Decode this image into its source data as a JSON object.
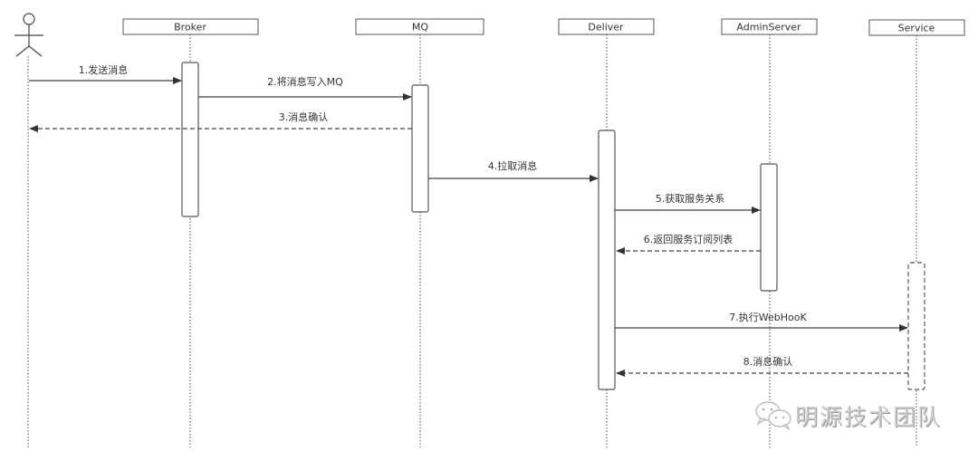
{
  "actor": {
    "name": "",
    "icon": "stick-figure-actor-icon"
  },
  "participants": [
    {
      "id": "broker",
      "label": "Broker"
    },
    {
      "id": "mq",
      "label": "MQ"
    },
    {
      "id": "deliver",
      "label": "Deliver"
    },
    {
      "id": "adminserver",
      "label": "AdminServer"
    },
    {
      "id": "service",
      "label": "Service"
    }
  ],
  "messages": [
    {
      "label": "1.发送消息",
      "from": "actor",
      "to": "broker",
      "style": "solid"
    },
    {
      "label": "2.将消息写入MQ",
      "from": "broker",
      "to": "mq",
      "style": "solid"
    },
    {
      "label": "3.消息确认",
      "from": "mq",
      "to": "actor",
      "style": "dashed"
    },
    {
      "label": "4.拉取消息",
      "from": "mq",
      "to": "deliver",
      "style": "solid"
    },
    {
      "label": "5.获取服务关系",
      "from": "deliver",
      "to": "adminserver",
      "style": "solid"
    },
    {
      "label": "6.返回服务订阅列表",
      "from": "adminserver",
      "to": "deliver",
      "style": "dashed"
    },
    {
      "label": "7.执行WebHooK",
      "from": "deliver",
      "to": "service",
      "style": "solid"
    },
    {
      "label": "8.消息确认",
      "from": "service",
      "to": "deliver",
      "style": "dashed"
    }
  ],
  "watermark": {
    "text": "明源技术团队",
    "icon": "wechat-icon"
  },
  "colors": {
    "line": "#555555",
    "text": "#333333",
    "background": "#ffffff"
  }
}
